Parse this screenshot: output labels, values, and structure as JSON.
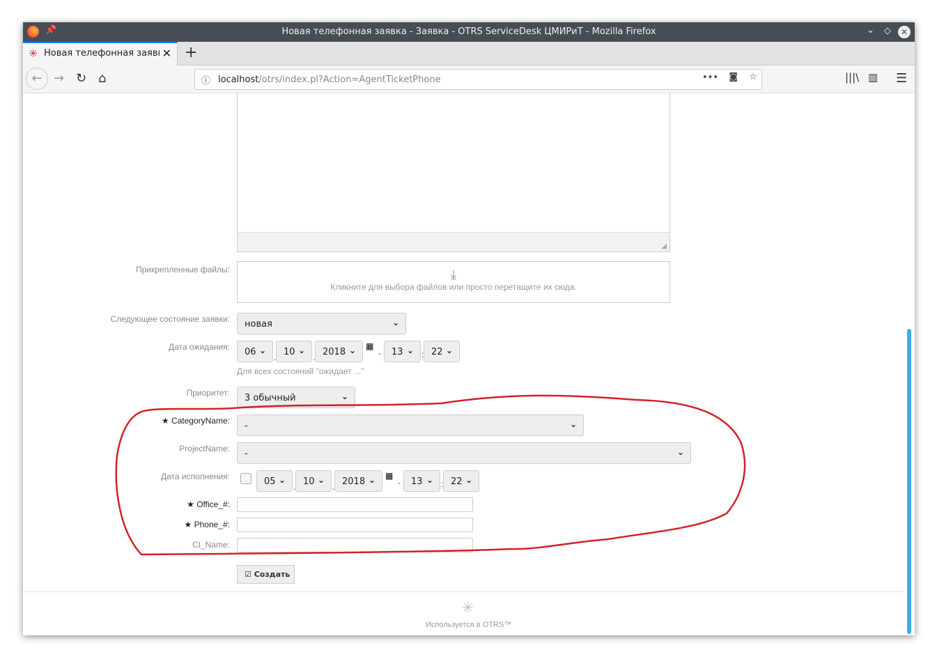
{
  "window": {
    "title": "Новая телефонная заявка - Заявка - OTRS ServiceDesk ЦМИРиТ - Mozilla Firefox"
  },
  "tab": {
    "label": "Новая телефонная заявка",
    "close": "✕",
    "new": "+"
  },
  "url": {
    "host": "localhost",
    "path": "/otrs/index.pl?Action=AgentTicketPhone"
  },
  "form": {
    "attachments": {
      "label": "Прикрепленные файлы:",
      "hint": "Кликните для выбора файлов или просто перетащите их сюда."
    },
    "next_state": {
      "label": "Следующее состояние заявки:",
      "value": "новая"
    },
    "pending_date": {
      "label": "Дата ожидания:",
      "day": "06",
      "month": "10",
      "year": "2018",
      "hour": "13",
      "minute": "22",
      "hint": "Для всех состояний \"ожидает ...\""
    },
    "priority": {
      "label": "Приоритет:",
      "value": "3 обычный"
    },
    "category": {
      "label": "CategoryName:",
      "value": "-",
      "required": true
    },
    "project": {
      "label": "ProjectName:",
      "value": "-"
    },
    "due_date": {
      "label": "Дата исполнения:",
      "checked": false,
      "day": "05",
      "month": "10",
      "year": "2018",
      "hour": "13",
      "minute": "22"
    },
    "office": {
      "label": "Office_#:",
      "value": "",
      "required": true
    },
    "phone": {
      "label": "Phone_#:",
      "value": "",
      "required": true
    },
    "ci_name": {
      "label": "CI_Name:",
      "value": ""
    },
    "submit": "Создать"
  },
  "footer": {
    "text": "Используется в OTRS™"
  },
  "colors": {
    "annotation": "#d42027",
    "scroll_thumb": "#3daee9",
    "titlebar": "#474d54"
  }
}
